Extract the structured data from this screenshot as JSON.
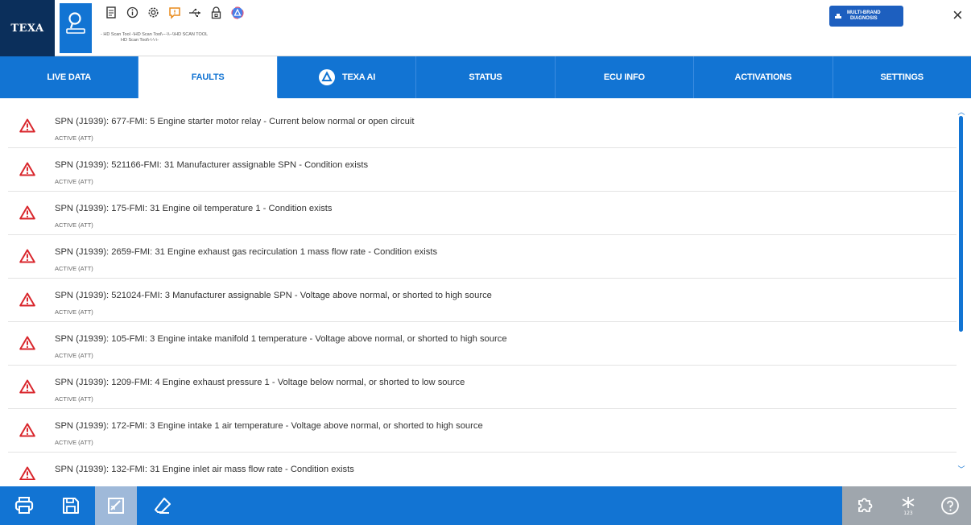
{
  "header": {
    "logo": "TEXA",
    "breadcrumb_line1": "- HD Scan Tool -\\HD Scan Tool\\---\\\\--\\\\HD SCAN TOOL",
    "breadcrumb_line2": "HD Scan Tool\\-\\-\\-\\-",
    "multibrand_line1": "MULTI-BRAND",
    "multibrand_line2": "DIAGNOSIS",
    "close": "×",
    "icons": [
      "document-icon",
      "info-icon",
      "gear-icon",
      "chat-icon",
      "usb-icon",
      "lock-icon",
      "texa-ai-icon"
    ]
  },
  "tabs": [
    {
      "label": "LIVE DATA",
      "active": false
    },
    {
      "label": "FAULTS",
      "active": true
    },
    {
      "label": "TEXA AI",
      "active": false
    },
    {
      "label": "STATUS",
      "active": false
    },
    {
      "label": "ECU INFO",
      "active": false
    },
    {
      "label": "ACTIVATIONS",
      "active": false
    },
    {
      "label": "SETTINGS",
      "active": false
    }
  ],
  "faults": [
    {
      "title": "SPN (J1939): 677-FMI: 5 Engine starter motor relay - Current below normal or open circuit",
      "status": "ACTIVE (ATT)"
    },
    {
      "title": "SPN (J1939): 521166-FMI: 31 Manufacturer assignable SPN - Condition exists",
      "status": "ACTIVE (ATT)"
    },
    {
      "title": "SPN (J1939): 175-FMI: 31 Engine oil temperature 1 - Condition exists",
      "status": "ACTIVE (ATT)"
    },
    {
      "title": "SPN (J1939): 2659-FMI: 31 Engine exhaust gas recirculation 1 mass flow rate - Condition exists",
      "status": "ACTIVE (ATT)"
    },
    {
      "title": "SPN (J1939): 521024-FMI: 3 Manufacturer assignable SPN - Voltage above normal, or shorted to high source",
      "status": "ACTIVE (ATT)"
    },
    {
      "title": "SPN (J1939): 105-FMI: 3 Engine intake manifold 1 temperature - Voltage above normal, or shorted to high source",
      "status": "ACTIVE (ATT)"
    },
    {
      "title": "SPN (J1939): 1209-FMI: 4 Engine exhaust pressure 1 - Voltage below normal, or shorted to low source",
      "status": "ACTIVE (ATT)"
    },
    {
      "title": "SPN (J1939): 172-FMI: 3 Engine intake 1 air temperature - Voltage above normal, or shorted to high source",
      "status": "ACTIVE (ATT)"
    },
    {
      "title": "SPN (J1939): 132-FMI: 31 Engine inlet air mass flow rate - Condition exists",
      "status": ""
    }
  ],
  "bottom": {
    "left_icons": [
      "print-icon",
      "save-icon",
      "edit-report-icon",
      "eraser-icon"
    ],
    "right_icons": [
      "ecu-puzzle-icon",
      "keypad-icon",
      "help-icon"
    ]
  },
  "colors": {
    "accent": "#1274d3",
    "warning": "#d9262c",
    "logo_bg": "#0b2f5b"
  }
}
